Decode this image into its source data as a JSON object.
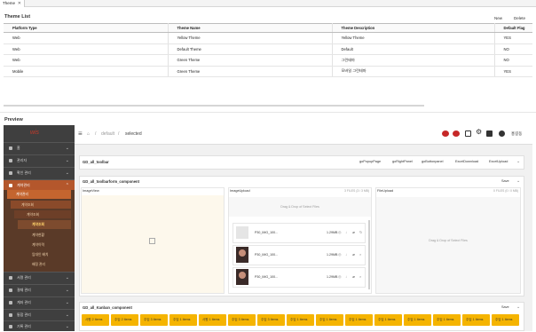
{
  "tab": {
    "label": "Theme",
    "close": "✕"
  },
  "theme_list": {
    "title": "Theme List",
    "new_label": "New",
    "delete_label": "Delete",
    "columns": [
      "Platform Type",
      "Theme Name",
      "Theme Description",
      "Default Flag"
    ],
    "rows": [
      [
        "Web",
        "Yellow Theme",
        "Yellow Theme",
        "YES"
      ],
      [
        "Web",
        "Default Theme",
        "Default",
        "NO"
      ],
      [
        "Web",
        "Green Theme",
        "그린테마",
        "NO"
      ],
      [
        "Mobile",
        "Green Theme",
        "모바일 그린테마",
        "YES"
      ]
    ]
  },
  "preview": {
    "title": "Preview",
    "logo": "wis",
    "sidebar": {
      "items": [
        "홈",
        "관리자",
        "확인 관리",
        "계약관리",
        "서명 관리",
        "결재 관리",
        "계좌 관리",
        "통합 관리",
        "기록 관리"
      ],
      "sub1": "계약관리",
      "sub2": "계약조회",
      "sub3_label": "계약조회",
      "sub4": [
        "계약현황",
        "계약이력",
        "임대인 배치",
        "배정 관리"
      ]
    },
    "breadcrumb": {
      "home": "⌂",
      "sep": "/",
      "level1": "default",
      "level2": "selected"
    },
    "user": "홍길동",
    "toolbar_panel": {
      "title": "GD_all_toolbar",
      "buttons": [
        "goPopupPage",
        "goRightPanel",
        "goButtonpanel",
        "ExcelDownload",
        "ExcelUpload"
      ]
    },
    "uploader_panel": {
      "title": "GD_all_toolbarform_component",
      "save_label": "Save",
      "image_view_label": "ImageView",
      "image_upload_label": "ImageUpload",
      "file_upload_label": "FileUpload",
      "file_upload_limit": "0 FILES (0 / 0 MB)",
      "image_upload_limit": "3 FILES (3 / 3 MB)",
      "drag_drop": "Drag & Drop of Select Files",
      "files": [
        {
          "name": "P30_IMG_100...",
          "size": "1.29MB"
        },
        {
          "name": "P30_IMG_100...",
          "size": "1.29MB"
        },
        {
          "name": "P30_IMG_100...",
          "size": "1.29MB"
        }
      ]
    },
    "kanban_panel": {
      "title": "GD_all_Kanban_component",
      "save_label": "Save",
      "cards": [
        "사원 2 Items",
        "주임 2 Items",
        "주임 3 Items",
        "주임 1 Items",
        "사원 1 Items",
        "주임 3 Items",
        "주임 3 Items",
        "주임 1 Items",
        "주임 1 Items",
        "주임 1 Items",
        "주임 1 Items",
        "주임 1 Items",
        "주임 1 Items",
        "주임 1 Items",
        "주임 1 Items"
      ]
    }
  },
  "colors": {
    "accent": "#f5b400",
    "sidebar": "#3f3f3f",
    "nav_active": "#b4572c",
    "logo": "#c03a2b"
  }
}
